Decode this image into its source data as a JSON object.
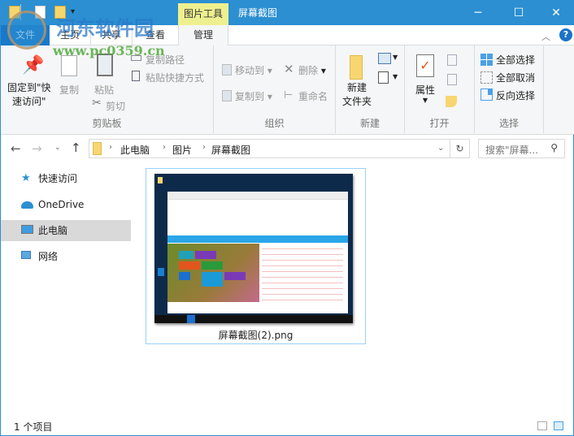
{
  "window": {
    "title": "屏幕截图",
    "context_tab": "图片工具",
    "controls": [
      "minimize",
      "maximize",
      "close"
    ]
  },
  "tabs": [
    {
      "label": "文件"
    },
    {
      "label": "主页"
    },
    {
      "label": "共享"
    },
    {
      "label": "查看"
    },
    {
      "label": "管理",
      "active": true
    }
  ],
  "watermark": {
    "text": "河东软件园",
    "url": "www.pc0359.cn"
  },
  "ribbon": {
    "clipboard": {
      "label": "剪贴板",
      "pin": "固定到\"快\n速访问\"",
      "pin1": "固定到\"快",
      "pin2": "速访问\"",
      "copy": "复制",
      "paste": "粘贴",
      "copy_path": "复制路径",
      "paste_shortcut": "粘贴快捷方式",
      "cut": "剪切"
    },
    "organize": {
      "label": "组织",
      "move_to": "移动到",
      "copy_to": "复制到",
      "delete": "删除",
      "rename": "重命名"
    },
    "new": {
      "label": "新建",
      "new_folder1": "新建",
      "new_folder2": "文件夹"
    },
    "open": {
      "label": "打开",
      "properties": "属性"
    },
    "select": {
      "label": "选择",
      "select_all": "全部选择",
      "select_none": "全部取消",
      "invert": "反向选择"
    }
  },
  "address": {
    "crumbs": [
      "此电脑",
      "图片",
      "屏幕截图"
    ],
    "search_placeholder": "搜索\"屏幕..."
  },
  "nav": [
    {
      "label": "快速访问",
      "icon": "star-icon"
    },
    {
      "label": "OneDrive",
      "icon": "cloud-icon"
    },
    {
      "label": "此电脑",
      "icon": "computer-icon",
      "selected": true
    },
    {
      "label": "网络",
      "icon": "network-icon"
    }
  ],
  "files": [
    {
      "name": "屏幕截图(2).png",
      "selected": true
    }
  ],
  "status": {
    "count": "1 个项目"
  },
  "colors": {
    "titlebar": "#2b8fd1",
    "context": "#eef08f",
    "selection": "#d9d9d9",
    "accent": "#1979ca"
  }
}
